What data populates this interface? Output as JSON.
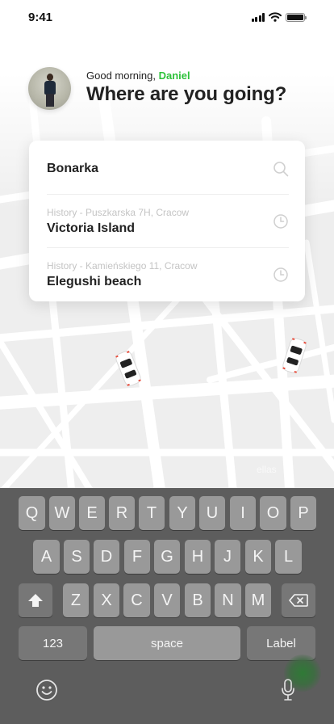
{
  "status_bar": {
    "time": "9:41"
  },
  "greeting": {
    "prefix": "Good morning, ",
    "name": "Daniel",
    "headline": "Where are you going?"
  },
  "search": {
    "value": "Bonarka",
    "icon": "search-icon"
  },
  "history": [
    {
      "meta": "History - Puszkarska 7H, Cracow",
      "title": "Victoria Island",
      "icon": "clock-icon"
    },
    {
      "meta": "History - Kamieńskiego 11, Cracow",
      "title": "Elegushi beach",
      "icon": "clock-icon"
    }
  ],
  "map": {
    "label": "ellas"
  },
  "keyboard": {
    "row1": [
      "Q",
      "W",
      "E",
      "R",
      "T",
      "Y",
      "U",
      "I",
      "O",
      "P"
    ],
    "row2": [
      "A",
      "S",
      "D",
      "F",
      "G",
      "H",
      "J",
      "K",
      "L"
    ],
    "row3": [
      "Z",
      "X",
      "C",
      "V",
      "B",
      "N",
      "M"
    ],
    "numbers_label": "123",
    "space_label": "space",
    "return_label": "Label",
    "shift_icon": "shift-icon",
    "delete_icon": "delete-icon",
    "emoji_icon": "emoji-icon",
    "mic_icon": "microphone-icon"
  },
  "colors": {
    "accent": "#2ec23b",
    "keyboard_bg": "#5d5d5d",
    "key_bg": "#999999"
  }
}
